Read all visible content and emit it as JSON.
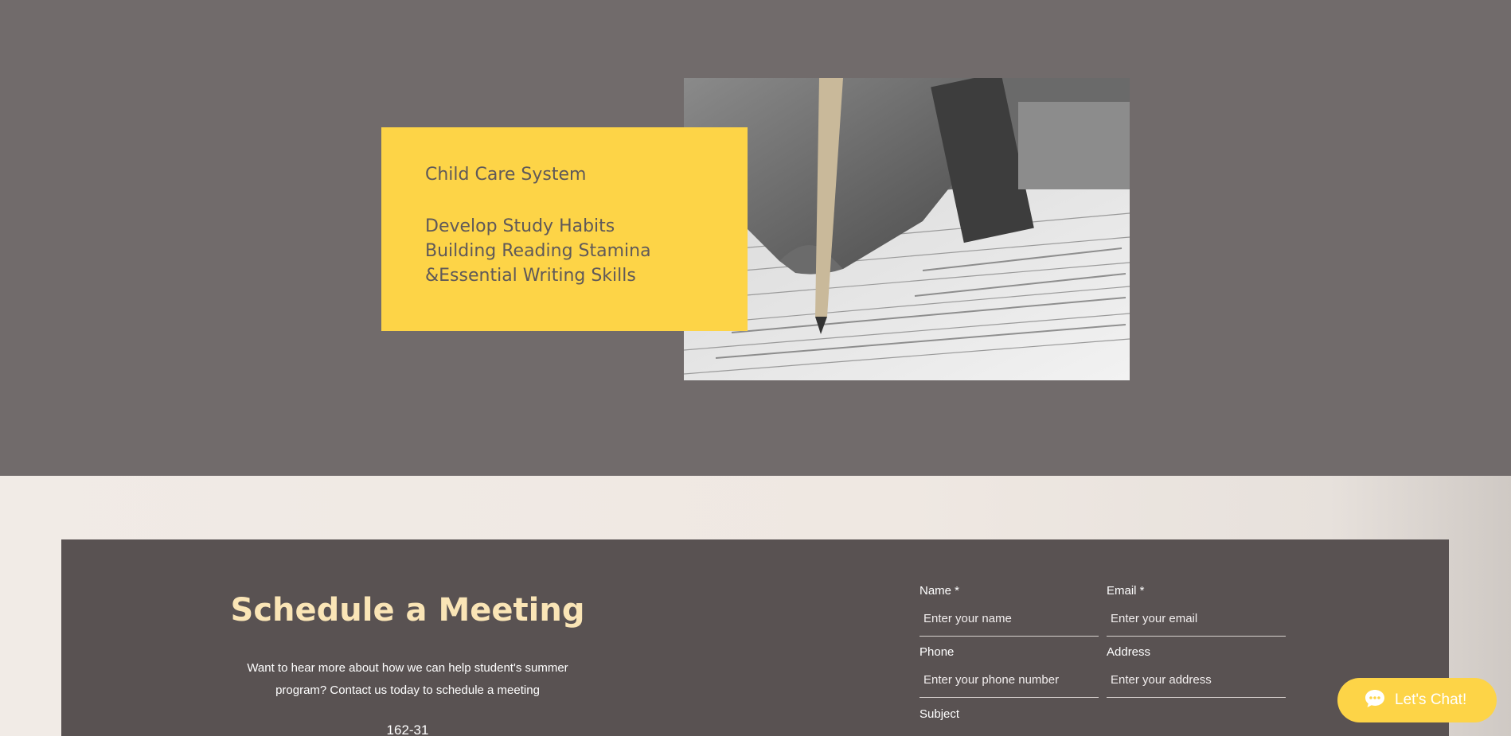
{
  "hero": {
    "card": {
      "title": "Child Care System",
      "lines": [
        "Develop Study Habits",
        "Building Reading Stamina",
        "&Essential Writing Skills"
      ]
    },
    "image_subject": "hand writing with pencil on lined paper"
  },
  "meeting": {
    "title": "Schedule a Meeting",
    "description": "Want to hear more about how we can help student's summer program? Contact us today to schedule a meeting",
    "phone_partial": "162-31",
    "form": {
      "name": {
        "label": "Name *",
        "placeholder": "Enter your name"
      },
      "email": {
        "label": "Email *",
        "placeholder": "Enter your email"
      },
      "phone": {
        "label": "Phone",
        "placeholder": "Enter your phone number"
      },
      "address": {
        "label": "Address",
        "placeholder": "Enter your address"
      },
      "subject": {
        "label": "Subject"
      }
    }
  },
  "chat": {
    "label": "Let's Chat!",
    "icon": "chat-bubble-icon"
  },
  "colors": {
    "accent_yellow": "#fdd447",
    "hero_bg": "#716b6b",
    "meeting_bg": "#595252",
    "meeting_title": "#fae5b6"
  }
}
